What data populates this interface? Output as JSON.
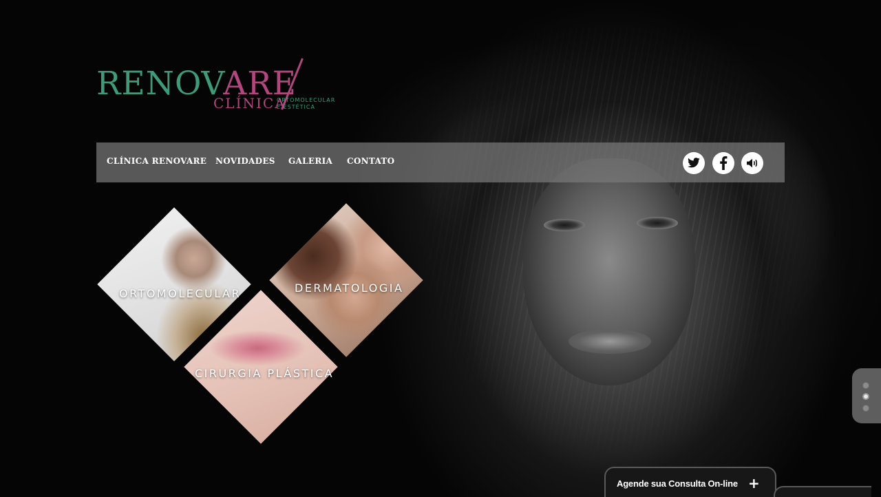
{
  "logo": {
    "word_main": "RENOV",
    "word_accent": "ARE",
    "clinica": "CLÍNICA",
    "sub_line1": "ORTOMOLECULAR",
    "sub_line2": "E ESTÉTICA",
    "colors": {
      "green": "#3f9a7a",
      "magenta": "#b0487e"
    }
  },
  "nav": {
    "items": [
      {
        "label": "CLÍNICA RENOVARE"
      },
      {
        "label": "NOVIDADES"
      },
      {
        "label": "GALERIA"
      },
      {
        "label": "CONTATO"
      }
    ],
    "social": [
      {
        "icon": "twitter-icon"
      },
      {
        "icon": "facebook-icon"
      },
      {
        "icon": "sound-icon"
      }
    ]
  },
  "services": [
    {
      "label": "ORTOMOLECULAR"
    },
    {
      "label": "DERMATOLOGIA"
    },
    {
      "label": "CIRURGIA PLÁSTICA"
    }
  ],
  "slider": {
    "count": 3,
    "active_index": 1
  },
  "appointment": {
    "label": "Agende sua Consulta On-line",
    "icon": "plus-icon"
  }
}
